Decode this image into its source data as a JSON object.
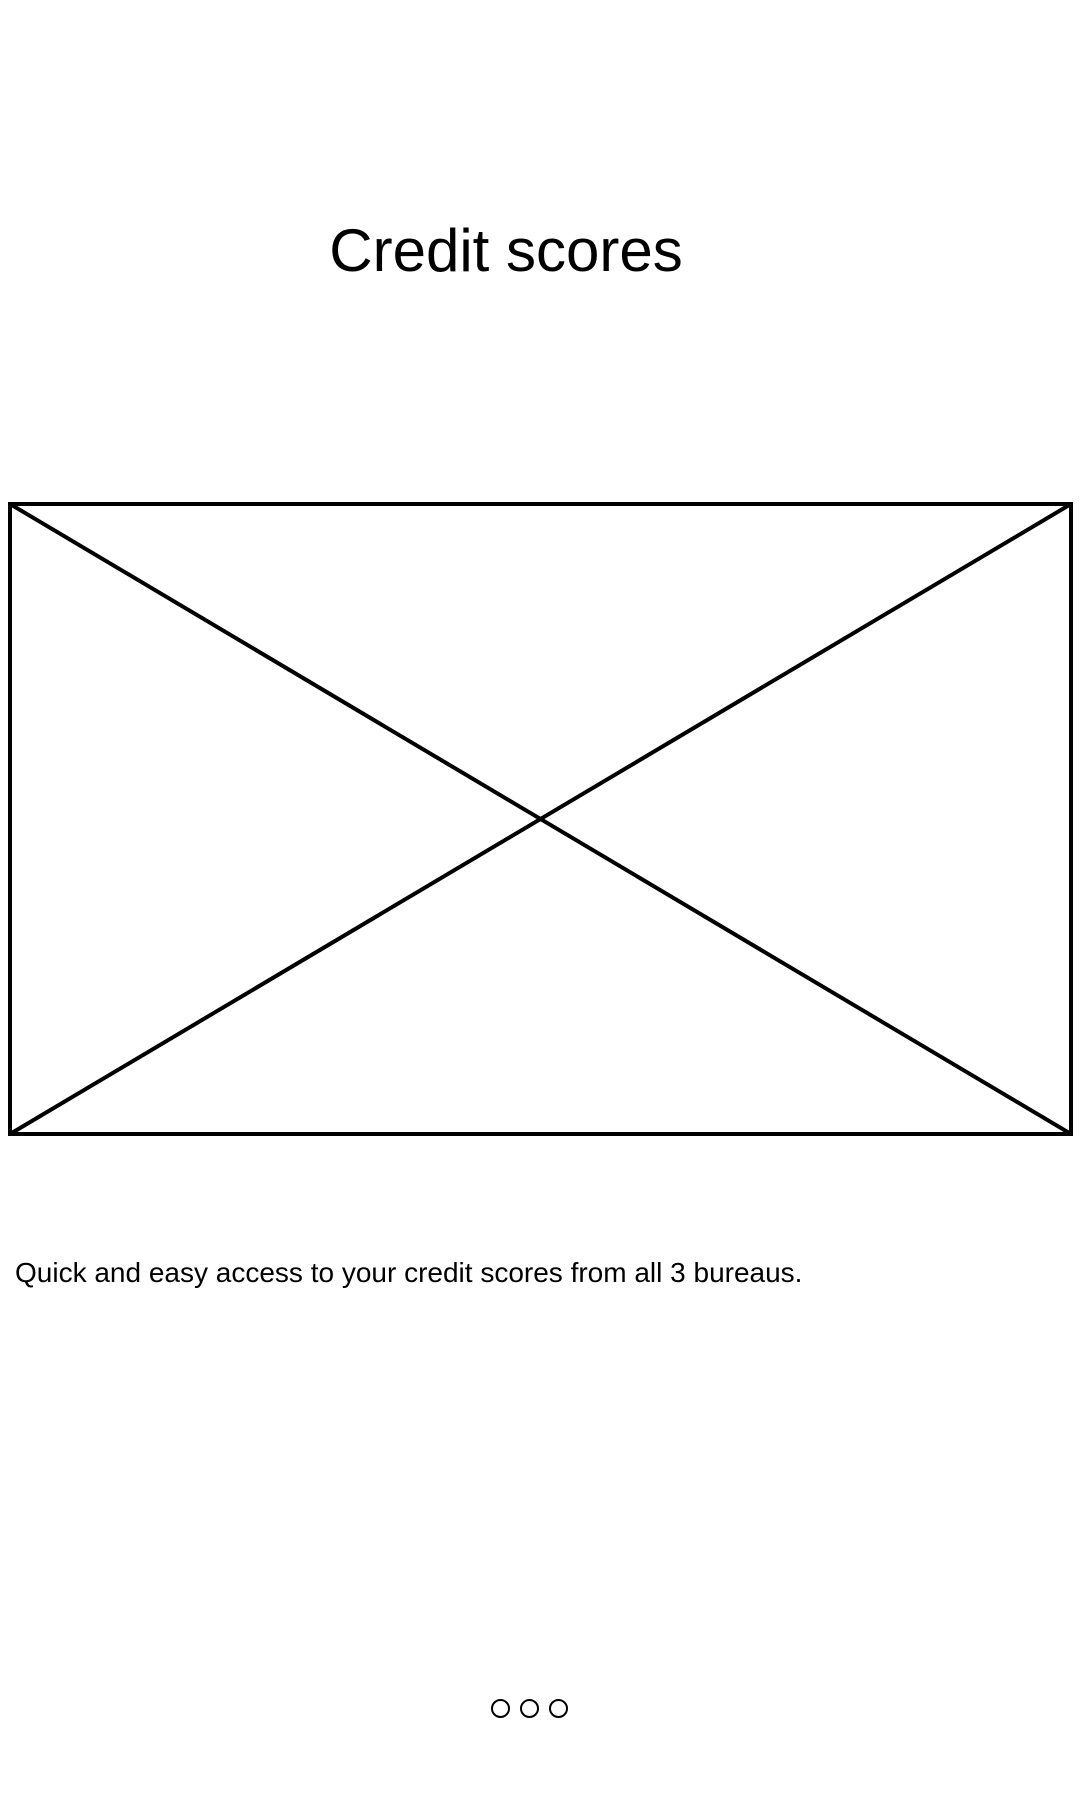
{
  "screen": {
    "title": "Credit scores",
    "description": "Quick and easy access to your credit scores from all 3 bureaus."
  },
  "image_placeholder": {
    "icon": "image-placeholder-icon"
  },
  "pager": {
    "page_count": 3,
    "icon": "page-indicator-dot"
  }
}
